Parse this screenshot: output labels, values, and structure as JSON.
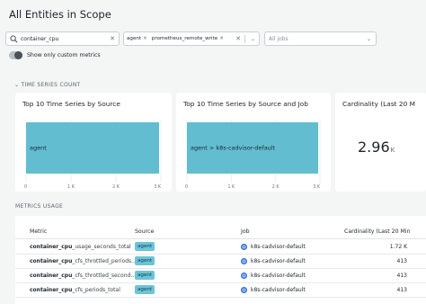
{
  "page": {
    "title": "All Entities in Scope"
  },
  "filters": {
    "search_value": "container_cpu",
    "sources": [
      "agent",
      "prometheus_remote_write"
    ],
    "jobs_placeholder": "All jobs"
  },
  "toggle": {
    "label": "Show only custom metrics",
    "on": true
  },
  "sections": {
    "time_series_count": "TIME SERIES COUNT",
    "metrics_usage": "METRICS USAGE"
  },
  "panels": {
    "by_source": {
      "title": "Top 10 Time Series by Source"
    },
    "by_source_job": {
      "title": "Top 10 Time Series by Source and Job"
    },
    "cardinality": {
      "title": "Cardinality (Last 20 M",
      "value": "2.96",
      "unit": "K"
    }
  },
  "chart_data": [
    {
      "type": "bar",
      "orientation": "horizontal",
      "title": "Top 10 Time Series by Source",
      "categories": [
        "agent"
      ],
      "values": [
        2960
      ],
      "xlim": [
        0,
        3000
      ],
      "ticks": [
        "0",
        "1 K",
        "2 K",
        "3 K"
      ],
      "color": "#62bdd0"
    },
    {
      "type": "bar",
      "orientation": "horizontal",
      "title": "Top 10 Time Series by Source and Job",
      "categories": [
        "agent > k8s-cadvisor-default"
      ],
      "values": [
        2960
      ],
      "xlim": [
        0,
        3000
      ],
      "ticks": [
        "0",
        "1 K",
        "2 K",
        "3 K"
      ],
      "color": "#62bdd0"
    }
  ],
  "table": {
    "headers": {
      "metric": "Metric",
      "source": "Source",
      "job": "Job",
      "cardinality": "Cardinality (Last 20 Min"
    },
    "rows": [
      {
        "metric_bold": "container_cpu",
        "metric_rest": "_usage_seconds_total",
        "source": "agent",
        "job": "k8s-cadvisor-default",
        "cardinality": "1.72 K"
      },
      {
        "metric_bold": "container_cpu",
        "metric_rest": "_cfs_throttled_periods...",
        "source": "agent",
        "job": "k8s-cadvisor-default",
        "cardinality": "413"
      },
      {
        "metric_bold": "container_cpu",
        "metric_rest": "_cfs_throttled_second...",
        "source": "agent",
        "job": "k8s-cadvisor-default",
        "cardinality": "413"
      },
      {
        "metric_bold": "container_cpu",
        "metric_rest": "_cfs_periods_total",
        "source": "agent",
        "job": "k8s-cadvisor-default",
        "cardinality": "413"
      }
    ]
  },
  "colors": {
    "accent": "#62bdd0",
    "tag": "#6cc4d8",
    "job_icon": "#326ce5"
  },
  "icons": {
    "search": "search-icon",
    "clear": "close-icon",
    "chevron": "chevron-down-icon",
    "kubernetes": "kubernetes-icon",
    "section": "chevron-down-icon"
  }
}
